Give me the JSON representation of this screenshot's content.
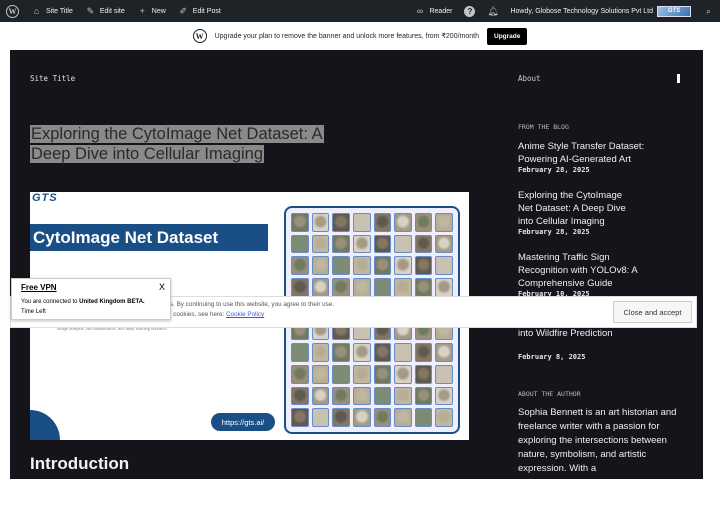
{
  "adminbar": {
    "site_title": "Site Title",
    "edit_site": "Edit site",
    "new": "New",
    "edit_post": "Edit Post",
    "reader": "Reader",
    "howdy": "Howdy, Globose Technology Solutions Pvt Ltd",
    "avatar_text": "GTS"
  },
  "banner": {
    "text": "Upgrade your plan to remove the banner and unlock more features, from ₹200/month",
    "button": "Upgrade"
  },
  "header": {
    "site_title": "Site Title",
    "nav_about": "About"
  },
  "post": {
    "title": "Exploring the CytoImage Net Dataset: A Deep Dive into Cellular Imaging",
    "section_heading": "Introduction"
  },
  "featured_image": {
    "logo": "GTS",
    "title": "CytoImage Net Dataset",
    "url_badge": "https://gts.ai/",
    "sub_text_1": "Image analysis, cell classification, and deep learning research."
  },
  "sidebar": {
    "from_blog_heading": "FROM THE BLOG",
    "posts": [
      {
        "title": "Anime Style Transfer Dataset: Powering AI-Generated Art",
        "date": "February 28, 2025"
      },
      {
        "title": "Exploring the CytoImage Net Dataset: A Deep Dive into Cellular Imaging",
        "date": "February 28, 2025"
      },
      {
        "title": "Mastering Traffic Sign Recognition with YOLOv8: A Comprehensive Guide",
        "date": "February 10, 2025"
      },
      {
        "title": "Smoke Dataset: Insights into Wildfire Prediction",
        "date": "February 8, 2025"
      }
    ],
    "about_author_heading": "ABOUT THE AUTHOR",
    "author_bio": "Sophia Bennett is an art historian and freelance writer with a passion for exploring the intersections between nature, symbolism, and artistic expression. With a"
  },
  "cookie": {
    "text_1": "Privacy & Cookies: This site uses cookies. By continuing to use this website, you agree to their use.",
    "text_2": "To find out more, including how to control cookies, see here:",
    "link": "Cookie Policy",
    "accept": "Close and accept"
  },
  "vpn": {
    "title": "Free VPN",
    "close": "X",
    "msg_prefix": "You are connected to",
    "location": "United Kingdom BETA.",
    "time_left": "Time Left"
  }
}
